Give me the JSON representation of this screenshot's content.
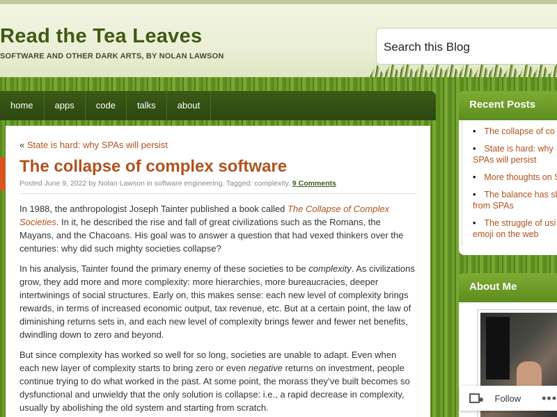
{
  "header": {
    "blog_title": "Read the Tea Leaves",
    "blog_description": "SOFTWARE AND OTHER DARK ARTS, BY NOLAN LAWSON",
    "search_placeholder": "Search this Blog"
  },
  "nav": {
    "items": [
      {
        "label": "home"
      },
      {
        "label": "apps"
      },
      {
        "label": "code"
      },
      {
        "label": "talks"
      },
      {
        "label": "about"
      }
    ]
  },
  "post": {
    "prev_prefix": "«",
    "prev_link": "State is hard: why SPAs will persist",
    "title": "The collapse of complex software",
    "meta_posted": "Posted June 9, 2022 by Nolan Lawson in software engineering. Tagged: complexity.",
    "meta_comments": "9 Comments",
    "p1_a": "In 1988, the anthropologist Joseph Tainter published a book called ",
    "p1_book": "The Collapse of Complex Societies",
    "p1_b": ". In it, he described the rise and fall of great civilizations such as the Romans, the Mayans, and the Chacoans. His goal was to answer a question that had vexed thinkers over the centuries: why did such mighty societies collapse?",
    "p2_a": "In his analysis, Tainter found the primary enemy of these societies to be ",
    "p2_em": "complexity",
    "p2_b": ". As civilizations grow, they add more and more complexity: more hierarchies, more bureaucracies, deeper intertwinings of social structures. Early on, this makes sense: each new level of complexity brings rewards, in terms of increased economic output, tax revenue, etc. But at a certain point, the law of diminishing returns sets in, and each new level of complexity brings fewer and fewer net benefits, dwindling down to zero and beyond.",
    "p3_a": "But since complexity has worked so well for so long, societies are unable to adapt. Even when each new layer of complexity starts to bring zero or even ",
    "p3_em": "negative",
    "p3_b": " returns on investment, people continue trying to do what worked in the past. At some point, the morass they’ve built becomes so dysfunctional and unwieldy that the only solution is collapse: i.e., a rapid decrease in complexity, usually by abolishing the old system and starting from scratch."
  },
  "sidebar": {
    "recent_title": "Recent Posts",
    "recent_items": [
      {
        "label": "The collapse of co"
      },
      {
        "label": "State is hard: why SPAs will persist"
      },
      {
        "label": "More thoughts on S"
      },
      {
        "label": "The balance has sh from SPAs"
      },
      {
        "label": "The struggle of usi emoji on the web"
      }
    ],
    "about_title": "About Me",
    "bullet": "•"
  },
  "follow": {
    "label": "Follow",
    "more": "•••"
  }
}
